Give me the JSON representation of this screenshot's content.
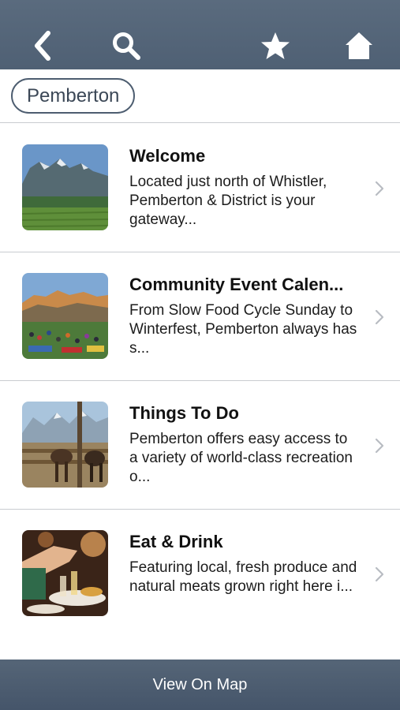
{
  "header": {
    "back_icon": "back-chevron-icon",
    "search_icon": "search-icon",
    "favorites_icon": "star-icon",
    "home_icon": "home-icon",
    "bar_color": "#546579"
  },
  "location_chip": {
    "label": "Pemberton"
  },
  "items": [
    {
      "title": "Welcome",
      "description": "Located just north of Whistler, Pemberton & District is your gateway...",
      "thumbnail": "mountain-field-photo"
    },
    {
      "title": "Community Event Calen...",
      "description": "From Slow Food Cycle Sunday to Winterfest, Pemberton always has s...",
      "thumbnail": "outdoor-festival-photo"
    },
    {
      "title": "Things To Do",
      "description": "Pemberton offers easy access to a variety of world-class recreation o...",
      "thumbnail": "horses-ranch-photo"
    },
    {
      "title": "Eat & Drink",
      "description": "Featuring local, fresh produce and natural meats grown right here i...",
      "thumbnail": "dining-table-photo"
    }
  ],
  "footer": {
    "map_button_label": "View On Map"
  }
}
